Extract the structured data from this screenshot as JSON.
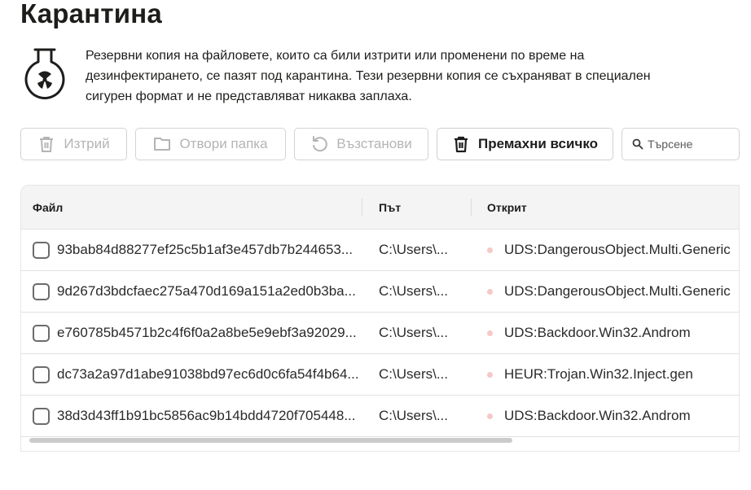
{
  "page": {
    "title": "Карантина"
  },
  "intro": {
    "icon": "radioactive-flask-icon",
    "lines": [
      "Резервни копия на файловете, които са били изтрити или променени по време на",
      "дезинфектирането, се пазят под карантина. Тези резервни копия се съхраняват в специален",
      "сигурен формат и не представляват никаква заплаха."
    ]
  },
  "toolbar": {
    "delete_label": "Изтрий",
    "open_folder_label": "Отвори папка",
    "restore_label": "Възстанови",
    "remove_all_label": "Премахни всичко",
    "search_placeholder": "Търсене"
  },
  "table": {
    "columns": {
      "file": "Файл",
      "path": "Път",
      "detected": "Открит"
    },
    "rows": [
      {
        "file": "93bab84d88277ef25c5b1af3e457db7b244653...",
        "path": "C:\\Users\\...",
        "detected": "UDS:DangerousObject.Multi.Generic"
      },
      {
        "file": "9d267d3bdcfaec275a470d169a151a2ed0b3ba...",
        "path": "C:\\Users\\...",
        "detected": "UDS:DangerousObject.Multi.Generic"
      },
      {
        "file": "e760785b4571b2c4f6f0a2a8be5e9ebf3a92029...",
        "path": "C:\\Users\\...",
        "detected": "UDS:Backdoor.Win32.Androm"
      },
      {
        "file": "dc73a2a97d1abe91038bd97ec6d0c6fa54f4b64...",
        "path": "C:\\Users\\...",
        "detected": "HEUR:Trojan.Win32.Inject.gen"
      },
      {
        "file": "38d3d43ff1b91bc5856ac9b14bdd4720f705448...",
        "path": "C:\\Users\\...",
        "detected": "UDS:Backdoor.Win32.Androm"
      }
    ]
  },
  "colors": {
    "text": "#1d1d1b",
    "disabled": "#b4b4b4",
    "threat_dot": "#f6c8c8",
    "header_bg": "#f4f4f4"
  }
}
